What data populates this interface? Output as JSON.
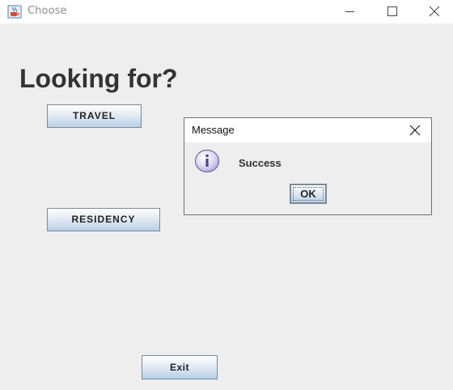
{
  "window": {
    "title": "Choose",
    "icon": "java-cup-icon",
    "controls": [
      "minimize-icon",
      "maximize-icon",
      "close-icon"
    ]
  },
  "main": {
    "heading": "Looking for?",
    "buttons": {
      "travel": "TRAVEL",
      "residency": "RESIDENCY",
      "exit": "Exit"
    }
  },
  "dialog": {
    "title": "Message",
    "icon": "info-icon",
    "message": "Success",
    "ok_label": "OK"
  }
}
